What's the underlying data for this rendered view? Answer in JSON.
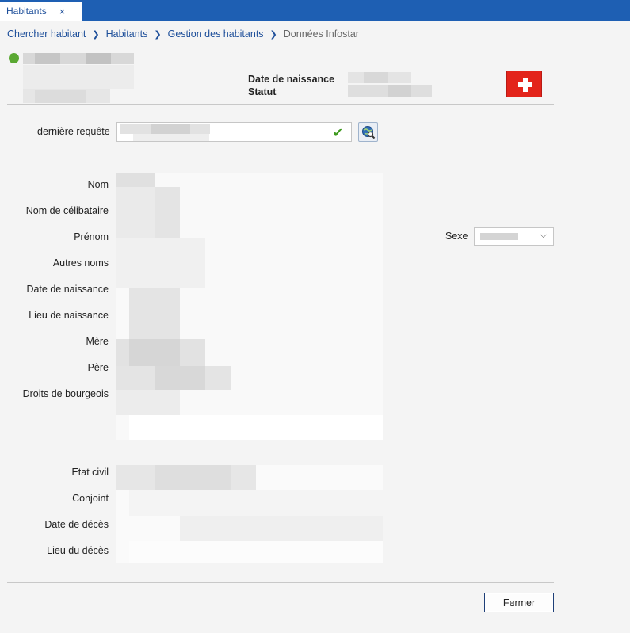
{
  "tab": {
    "label": "Habitants",
    "close_glyph": "×"
  },
  "breadcrumb": {
    "items": [
      "Chercher habitant",
      "Habitants",
      "Gestion des habitants",
      "Données Infostar"
    ]
  },
  "header": {
    "birth_label": "Date de naissance",
    "status_label": "Statut",
    "status_color": "#5aa832",
    "flag": "swiss-flag-icon"
  },
  "query": {
    "label": "dernière requête",
    "check_icon": "checkmark-icon",
    "search_icon": "globe-search-icon"
  },
  "fields": {
    "nom": "Nom",
    "nom_celibataire": "Nom de célibataire",
    "prenom": "Prénom",
    "autres_noms": "Autres noms",
    "date_naissance": "Date de naissance",
    "lieu_naissance": "Lieu de naissance",
    "mere": "Mère",
    "pere": "Père",
    "droits_bourgeois": "Droits de bourgeois",
    "etat_civil": "Etat civil",
    "conjoint": "Conjoint",
    "date_deces": "Date de décès",
    "lieu_deces": "Lieu du décès"
  },
  "sexe": {
    "label": "Sexe"
  },
  "footer": {
    "close_label": "Fermer"
  },
  "colors": {
    "accent": "#1e5fb3",
    "link": "#1e4f9a",
    "flag_red": "#e3241b"
  }
}
